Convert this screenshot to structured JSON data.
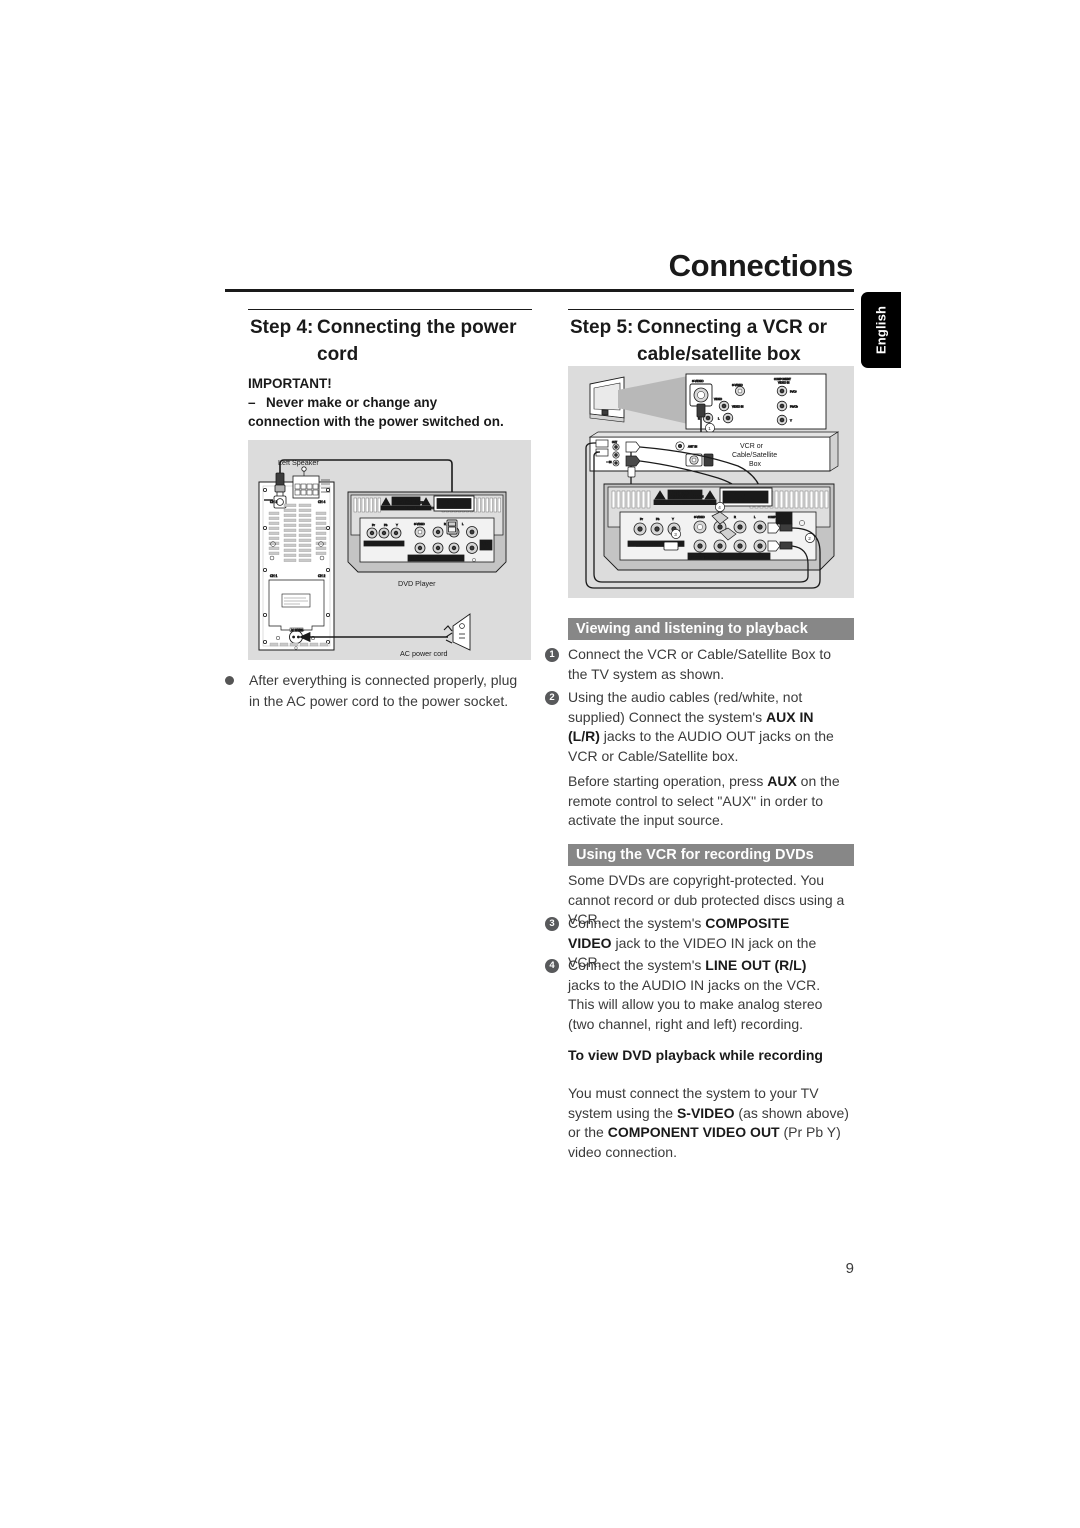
{
  "document": {
    "chapter_title": "Connections",
    "language_tab": "English",
    "page_number": "9"
  },
  "left_column": {
    "step_label": "Step 4:",
    "step_title": "Connecting the power cord",
    "important": {
      "heading": "IMPORTANT!",
      "dash": "–",
      "line1": "Never make or change any",
      "line2": "connection with the power switched on."
    },
    "diagram": {
      "name": "power-cord-connection-diagram",
      "labels": {
        "left_speaker": "Left Speaker",
        "dvd_player": "DVD Player",
        "ac_power_cord": "AC power cord",
        "laser_warning": "CLASS 1 LASER PRODUCT",
        "caution": "CAUTION VISIBLE AND INVISIBLE LASER RADIATION WHEN OPEN AVOID EXPOSURE TO BEAM",
        "component_video_out": "COMPONENT VIDEO OUT",
        "pr_pb_y": "Pr   Pb   Y",
        "s_video": "S-VIDEO",
        "aux_in": "AUX IN",
        "line_out": "LINE OUT",
        "digital_out": "DIGITAL OUT",
        "composite": "COMPOSITE",
        "video_out": "VIDEO OUT",
        "speaker_rating": "RATED 30W 8 OHM IMPEDANCE"
      }
    },
    "bullet": {
      "text": "After everything is connected properly, plug in the AC power cord to the power socket."
    }
  },
  "right_column": {
    "step_label": "Step 5:",
    "step_title": "Connecting a VCR or cable/satellite box",
    "diagram": {
      "name": "vcr-cable-satellite-connection-diagram",
      "labels": {
        "vcr_box": "VCR or Cable/Satellite Box",
        "tv": "TV",
        "laser_warning": "CLASS 1 LASER PRODUCT",
        "component_video_in": "COMPONENT VIDEO IN",
        "s_video": "S-VIDEO",
        "video_in": "VIDEO IN",
        "antenna": "ANT IN",
        "pr": "Pr",
        "pb": "Pb",
        "y": "Y",
        "callout_1": "1",
        "callout_2": "2",
        "callout_3": "3",
        "callout_4": "4"
      }
    },
    "sections": [
      {
        "heading": "Viewing and listening to playback",
        "items": [
          {
            "number": "1",
            "text": "Connect the VCR or Cable/Satellite Box to the TV system as shown."
          },
          {
            "number": "2",
            "text_parts": [
              {
                "t": "Using the audio cables (red/white, not supplied) Connect the system's ",
                "bold": false
              },
              {
                "t": "AUX IN (L/R)",
                "bold": true
              },
              {
                "t": " jacks to the AUDIO OUT jacks on the VCR or Cable/Satellite box.",
                "bold": false
              }
            ]
          }
        ],
        "paragraph_parts": [
          {
            "t": "Before starting operation, press ",
            "bold": false
          },
          {
            "t": "AUX",
            "bold": true
          },
          {
            "t": " on the remote control to select \"AUX\" in order to activate the input source.",
            "bold": false
          }
        ]
      },
      {
        "heading": "Using the VCR for recording DVDs",
        "paragraph": "Some DVDs are copyright-protected. You cannot record or dub protected discs using a VCR.",
        "items": [
          {
            "number": "3",
            "text_parts": [
              {
                "t": "Connect the system's ",
                "bold": false
              },
              {
                "t": "COMPOSITE VIDEO",
                "bold": true
              },
              {
                "t": " jack to the VIDEO IN jack on the VCR.",
                "bold": false
              }
            ]
          },
          {
            "number": "4",
            "text_parts": [
              {
                "t": "Connect the system's ",
                "bold": false
              },
              {
                "t": "LINE OUT (R/L)",
                "bold": true
              },
              {
                "t": " jacks to the AUDIO IN jacks on the VCR.  This will allow you to make analog stereo (two channel, right and left) recording.",
                "bold": false
              }
            ]
          }
        ],
        "subsection": {
          "heading": "To view DVD playback while recording",
          "paragraph_parts": [
            {
              "t": "You must connect the system to your TV system using the ",
              "bold": false
            },
            {
              "t": "S-VIDEO",
              "bold": true
            },
            {
              "t": " (as shown above) or the ",
              "bold": false
            },
            {
              "t": "COMPONENT VIDEO OUT",
              "bold": true
            },
            {
              "t": " (Pr Pb Y) video connection.",
              "bold": false
            }
          ]
        }
      }
    ]
  },
  "colors": {
    "text": "#231f20",
    "body_text": "#3b3b3b",
    "heading": "#1a1a1a",
    "diagram_bg": "#dcdcdc",
    "section_header_bg": "#878787",
    "section_header_text": "#ffffff",
    "tab_bg": "#000000",
    "bullet": "#555555",
    "number_badge": "#58595b"
  }
}
